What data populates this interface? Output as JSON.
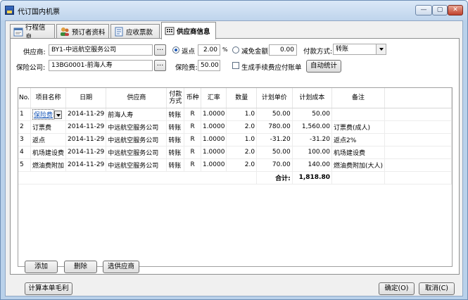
{
  "window": {
    "title": "代订国内机票",
    "minimize": "—",
    "maximize": "▢",
    "close": "✕"
  },
  "tabs": [
    {
      "label": "行程信息",
      "icon": "itinerary-icon",
      "active": false
    },
    {
      "label": "预订者资料",
      "icon": "people-icon",
      "active": false
    },
    {
      "label": "应收票款",
      "icon": "receivable-icon",
      "active": false
    },
    {
      "label": "供应商信息",
      "icon": "supplier-icon",
      "active": true
    }
  ],
  "form": {
    "supplier_label": "供应商:",
    "supplier_value": "BY1-中远航空服务公司",
    "insurer_label": "保险公司:",
    "insurer_value": "13BG0001-前海人寿",
    "rebate_label": "返点",
    "rebate_value": "2.00",
    "rebate_unit": "%",
    "discount_label": "减免金额",
    "discount_value": "0.00",
    "payment_label": "付款方式:",
    "payment_value": "转账",
    "insurance_fee_label": "保险费:",
    "insurance_fee_value": "50.00",
    "gen_fee_label": "生成手续费应付账单",
    "auto_stat_label": "自动统计",
    "browse_label": "..."
  },
  "table": {
    "columns": [
      "No.",
      "项目名称",
      "日期",
      "供应商",
      "付款\n方式",
      "币种",
      "汇率",
      "数量",
      "计划单价",
      "计划成本",
      "备注"
    ],
    "rows": [
      {
        "no": "1",
        "item": "保险费",
        "date": "2014-11-29",
        "supplier": "前海人寿",
        "pay": "转账",
        "currency": "R",
        "rate": "1.0000",
        "qty": "1.0",
        "price": "50.00",
        "cost": "50.00",
        "note": ""
      },
      {
        "no": "2",
        "item": "订票费",
        "date": "2014-11-29",
        "supplier": "中远航空服务公司",
        "pay": "转账",
        "currency": "R",
        "rate": "1.0000",
        "qty": "2.0",
        "price": "780.00",
        "cost": "1,560.00",
        "note": "订票费(成人)"
      },
      {
        "no": "3",
        "item": "返点",
        "date": "2014-11-29",
        "supplier": "中远航空服务公司",
        "pay": "转账",
        "currency": "R",
        "rate": "1.0000",
        "qty": "1.0",
        "price": "-31.20",
        "cost": "-31.20",
        "note": "返点2%"
      },
      {
        "no": "4",
        "item": "机场建设费",
        "date": "2014-11-29",
        "supplier": "中远航空服务公司",
        "pay": "转账",
        "currency": "R",
        "rate": "1.0000",
        "qty": "2.0",
        "price": "50.00",
        "cost": "100.00",
        "note": "机场建设费"
      },
      {
        "no": "5",
        "item": "燃油费附加",
        "date": "2014-11-29",
        "supplier": "中远航空服务公司",
        "pay": "转账",
        "currency": "R",
        "rate": "1.0000",
        "qty": "2.0",
        "price": "70.00",
        "cost": "140.00",
        "note": "燃油费附加(大人)"
      }
    ],
    "total_label": "合计:",
    "total_value": "1,818.80"
  },
  "buttons": {
    "add": "添加",
    "delete": "删除",
    "select_supplier": "选供应商",
    "calc_margin": "计算本单毛利",
    "ok": "确定(O)",
    "cancel": "取消(C)"
  },
  "colors": {
    "titlebar": "#c9dcf2",
    "accent": "#1a58b8"
  }
}
